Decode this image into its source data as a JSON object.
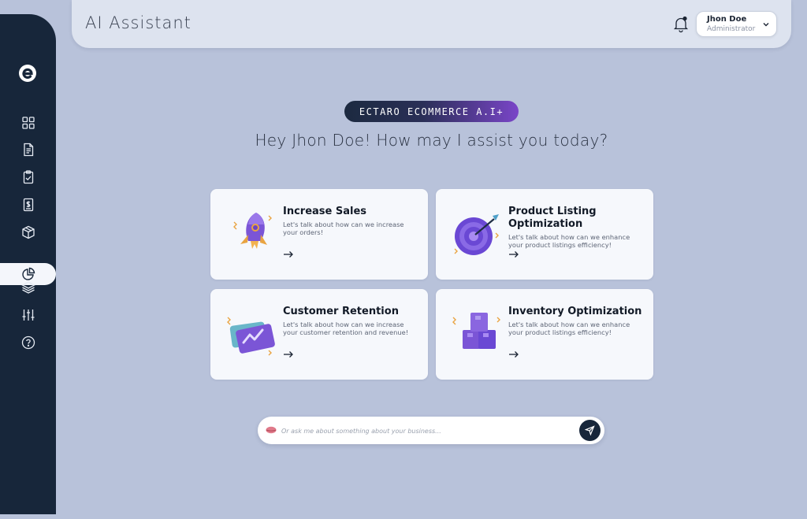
{
  "header": {
    "title": "AI Assistant",
    "user_name": "Jhon Doe",
    "user_role": "Administrator"
  },
  "sidebar": {
    "items": [
      {
        "icon": "dashboard-grid-icon"
      },
      {
        "icon": "document-icon"
      },
      {
        "icon": "clipboard-check-icon"
      },
      {
        "icon": "invoice-dollar-icon"
      },
      {
        "icon": "package-box-icon"
      },
      {
        "icon": "pie-chart-icon",
        "active": true
      },
      {
        "icon": "layers-icon"
      },
      {
        "icon": "sliders-icon"
      },
      {
        "icon": "help-circle-icon"
      }
    ]
  },
  "main": {
    "badge": "ECTARO ECOMMERCE A.I+",
    "greeting": "Hey Jhon Doe! How may I assist you today?",
    "cards": [
      {
        "title": "Increase Sales",
        "description": "Let's talk about how can we increase your orders!",
        "illustration": "rocket-icon"
      },
      {
        "title": "Product Listing Optimization",
        "description": "Let's talk about how can we enhance your product listings efficiency!",
        "illustration": "target-icon"
      },
      {
        "title": "Customer Retention",
        "description": "Let's talk about how can we increase your customer retention and revenue!",
        "illustration": "credit-card-icon"
      },
      {
        "title": "Inventory Optimization",
        "description": "Let's talk about how can we enhance your product listings efficiency!",
        "illustration": "boxes-icon"
      }
    ]
  },
  "chat": {
    "placeholder": "Or ask me about something about your business...",
    "value": ""
  },
  "colors": {
    "background": "#b8c2da",
    "sidebar": "#17263a",
    "header": "#dde3ef",
    "accent": "#7a45c8"
  }
}
